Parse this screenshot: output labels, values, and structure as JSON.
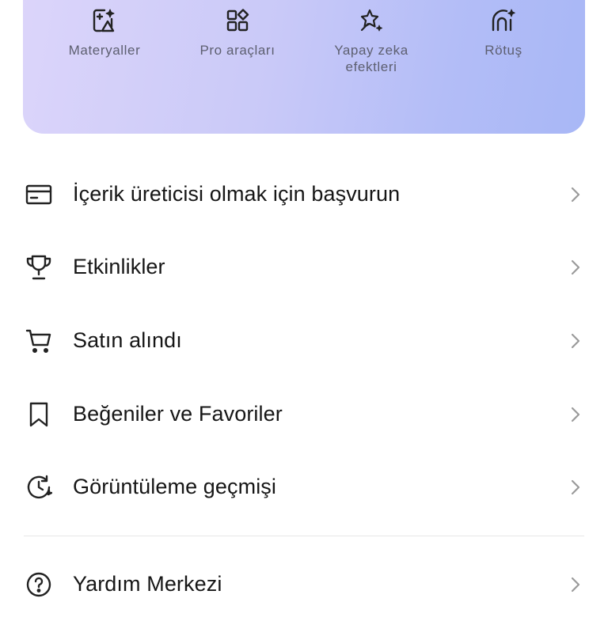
{
  "tools": [
    {
      "label": "Materyaller",
      "icon": "image-sparkle-icon"
    },
    {
      "label": "Pro araçları",
      "icon": "apps-grid-icon"
    },
    {
      "label": "Yapay zeka efektleri",
      "icon": "magic-stars-icon"
    },
    {
      "label": "Rötuş",
      "icon": "retouch-face-icon"
    }
  ],
  "menu": {
    "creator_apply": "İçerik üreticisi olmak için başvurun",
    "events": "Etkinlikler",
    "purchased": "Satın alındı",
    "likes_favorites": "Beğeniler ve Favoriler",
    "watch_history": "Görüntüleme geçmişi",
    "help_center": "Yardım Merkezi"
  },
  "colors": {
    "hero_start": "#dcd5fa",
    "hero_end": "#a8b7f6",
    "chevron": "#9a9a9a"
  }
}
